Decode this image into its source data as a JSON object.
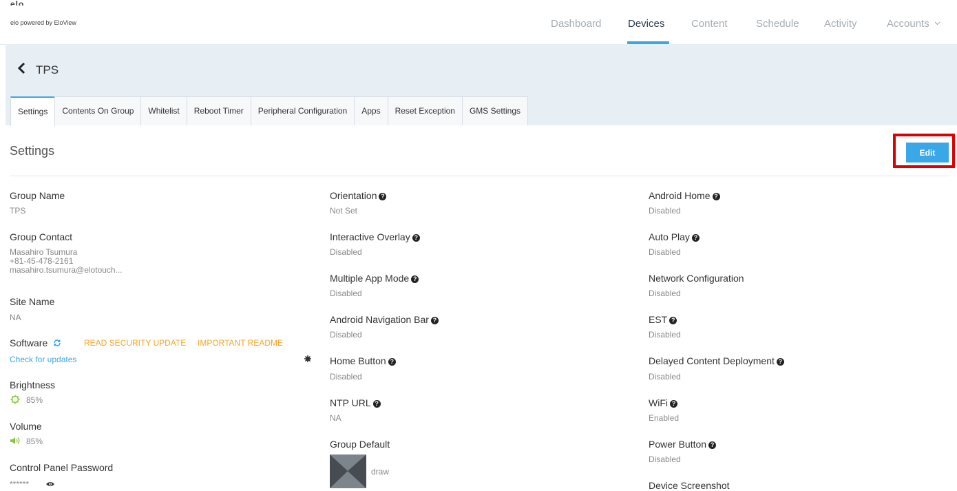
{
  "brand": {
    "mark": "elo",
    "tagline": "elo powered by EloView"
  },
  "nav": {
    "items": [
      "Dashboard",
      "Devices",
      "Content",
      "Schedule",
      "Activity",
      "Accounts"
    ],
    "active": "Devices"
  },
  "group": {
    "title": "TPS"
  },
  "tabs": [
    "Settings",
    "Contents On Group",
    "Whitelist",
    "Reboot Timer",
    "Peripheral Configuration",
    "Apps",
    "Reset Exception",
    "GMS Settings"
  ],
  "settings": {
    "heading": "Settings",
    "edit_label": "Edit"
  },
  "col1": {
    "group_name_label": "Group Name",
    "group_name_value": "TPS",
    "group_contact_label": "Group Contact",
    "contact_name": "Masahiro Tsumura",
    "contact_phone": "+81-45-478-2161",
    "contact_email": "masahiro.tsumura@elotouch...",
    "site_name_label": "Site Name",
    "site_name_value": "NA",
    "software_label": "Software",
    "read_security_update": "READ SECURITY UPDATE",
    "important_readme": "IMPORTANT README",
    "check_updates": "Check for updates",
    "brightness_label": "Brightness",
    "brightness_value": "85%",
    "volume_label": "Volume",
    "volume_value": "85%",
    "cp_password_label": "Control Panel Password",
    "cp_password_value": "******"
  },
  "col2": {
    "orientation_label": "Orientation",
    "orientation_value": "Not Set",
    "overlay_label": "Interactive Overlay",
    "overlay_value": "Disabled",
    "multi_app_label": "Multiple App Mode",
    "multi_app_value": "Disabled",
    "nav_bar_label": "Android Navigation Bar",
    "nav_bar_value": "Disabled",
    "home_button_label": "Home Button",
    "home_button_value": "Disabled",
    "ntp_label": "NTP URL",
    "ntp_value": "NA",
    "group_default_label": "Group Default",
    "group_default_value": "draw"
  },
  "col3": {
    "android_home_label": "Android Home",
    "android_home_value": "Disabled",
    "auto_play_label": "Auto Play",
    "auto_play_value": "Disabled",
    "network_label": "Network Configuration",
    "network_value": "Disabled",
    "est_label": "EST",
    "est_value": "Disabled",
    "delayed_label": "Delayed Content Deployment",
    "delayed_value": "Disabled",
    "wifi_label": "WiFi",
    "wifi_value": "Enabled",
    "power_label": "Power Button",
    "power_value": "Disabled",
    "screenshot_label": "Device Screenshot"
  },
  "colors": {
    "accent": "#3aa8e8",
    "link_orange": "#f5a623",
    "highlight": "#e00000",
    "band": "#e7eef4"
  },
  "icons": [
    "chevron-left-icon",
    "refresh-icon",
    "gear-icon",
    "brightness-icon",
    "volume-icon",
    "eye-icon",
    "help-icon",
    "chevron-down-icon"
  ]
}
